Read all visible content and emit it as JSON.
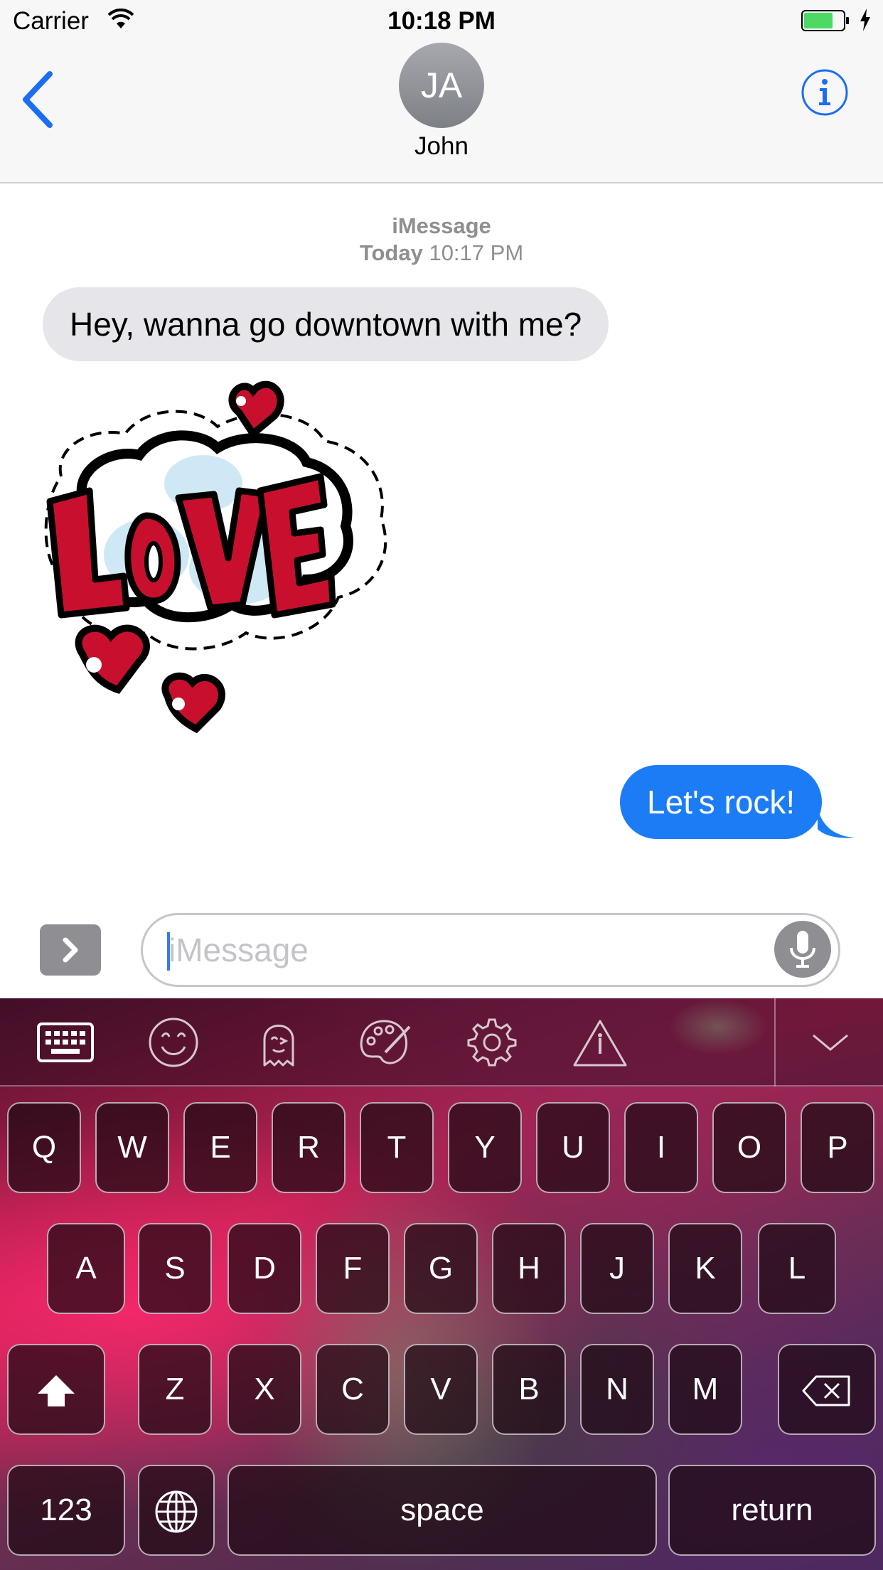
{
  "status_bar": {
    "carrier": "Carrier",
    "time": "10:18 PM",
    "battery_color": "#4cd964"
  },
  "nav": {
    "avatar_initials": "JA",
    "contact_name": "John",
    "accent_color": "#1b6ef3"
  },
  "conversation": {
    "service": "iMessage",
    "timestamp_day": "Today",
    "timestamp_time": "10:17 PM",
    "messages": [
      {
        "direction": "incoming",
        "text": "Hey, wanna go downtown with me?"
      },
      {
        "direction": "incoming",
        "type": "sticker",
        "sticker": "LOVE"
      },
      {
        "direction": "outgoing",
        "text": "Let's rock!"
      }
    ]
  },
  "input": {
    "placeholder": "iMessage"
  },
  "keyboard": {
    "toolbar_icons": [
      "keyboard-icon",
      "smiley-icon",
      "ghost-icon",
      "palette-icon",
      "gear-icon",
      "warning-icon",
      "chevron-down-icon"
    ],
    "row1": [
      "Q",
      "W",
      "E",
      "R",
      "T",
      "Y",
      "U",
      "I",
      "O",
      "P"
    ],
    "row2": [
      "A",
      "S",
      "D",
      "F",
      "G",
      "H",
      "J",
      "K",
      "L"
    ],
    "row3": [
      "Z",
      "X",
      "C",
      "V",
      "B",
      "N",
      "M"
    ],
    "numbers_label": "123",
    "space_label": "space",
    "return_label": "return"
  }
}
